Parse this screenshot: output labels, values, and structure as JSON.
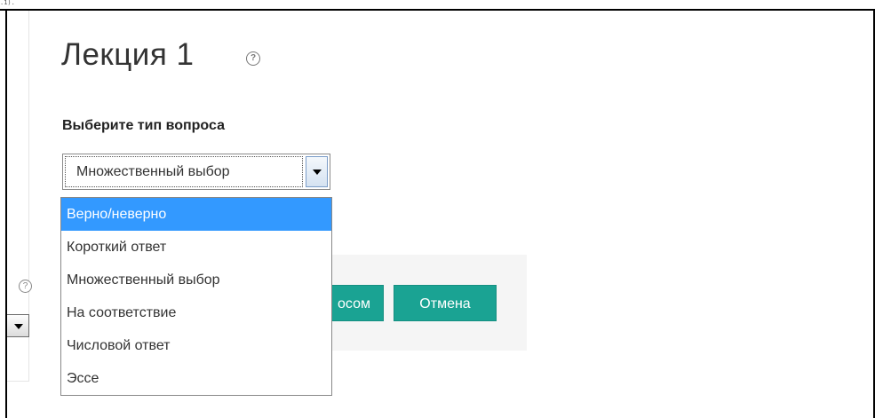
{
  "top_artifact": ".1).",
  "left_panel": {
    "help_icon": "help-circle-icon",
    "help_glyph": "?"
  },
  "page": {
    "title": "Лекция 1",
    "title_help_glyph": "?"
  },
  "question_type": {
    "label": "Выберите тип вопроса",
    "selected": "Множественный выбор",
    "options": [
      "Верно/неверно",
      "Короткий ответ",
      "Множественный выбор",
      "На соответствие",
      "Числовой ответ",
      "Эссе"
    ],
    "highlighted_option": "Верно/неверно"
  },
  "actions": {
    "add_label_partial": "осом",
    "cancel_label": "Отмена"
  },
  "colors": {
    "accent_button": "#1aa393",
    "dropdown_highlight": "#3399ff"
  }
}
